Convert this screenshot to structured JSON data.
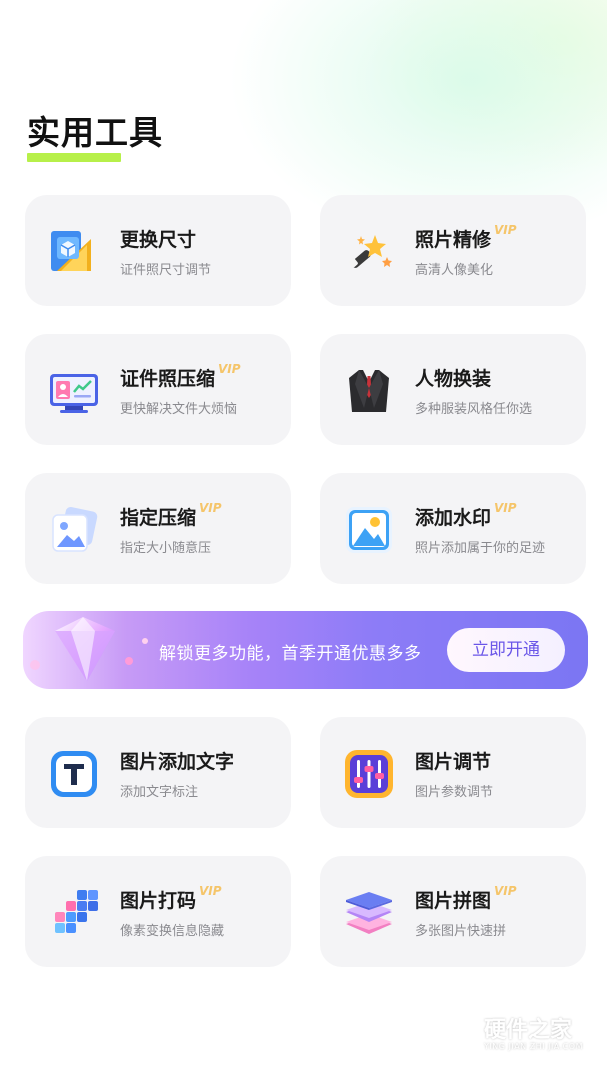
{
  "section_title": "实用工具",
  "vip_label": "VIP",
  "tools_top": [
    {
      "name": "更换尺寸",
      "desc": "证件照尺寸调节",
      "vip": false,
      "icon": "resize-ruler-icon"
    },
    {
      "name": "照片精修",
      "desc": "高清人像美化",
      "vip": true,
      "icon": "magic-wand-icon"
    },
    {
      "name": "证件照压缩",
      "desc": "更快解决文件大烦恼",
      "vip": true,
      "icon": "monitor-chart-icon"
    },
    {
      "name": "人物换装",
      "desc": "多种服装风格任你选",
      "vip": false,
      "icon": "suit-icon"
    },
    {
      "name": "指定压缩",
      "desc": "指定大小随意压",
      "vip": true,
      "icon": "image-stack-icon"
    },
    {
      "name": "添加水印",
      "desc": "照片添加属于你的足迹",
      "vip": true,
      "icon": "picture-icon"
    }
  ],
  "banner": {
    "text": "解锁更多功能，首季开通优惠多多",
    "button": "立即开通"
  },
  "tools_bottom": [
    {
      "name": "图片添加文字",
      "desc": "添加文字标注",
      "vip": false,
      "icon": "text-t-icon"
    },
    {
      "name": "图片调节",
      "desc": "图片参数调节",
      "vip": false,
      "icon": "sliders-icon"
    },
    {
      "name": "图片打码",
      "desc": "像素变换信息隐藏",
      "vip": true,
      "icon": "pixel-cubes-icon"
    },
    {
      "name": "图片拼图",
      "desc": "多张图片快速拼",
      "vip": true,
      "icon": "layers-icon"
    }
  ],
  "watermark": {
    "text": "硬件之家",
    "sub": "YING JIAN ZHI JIA.COM"
  }
}
